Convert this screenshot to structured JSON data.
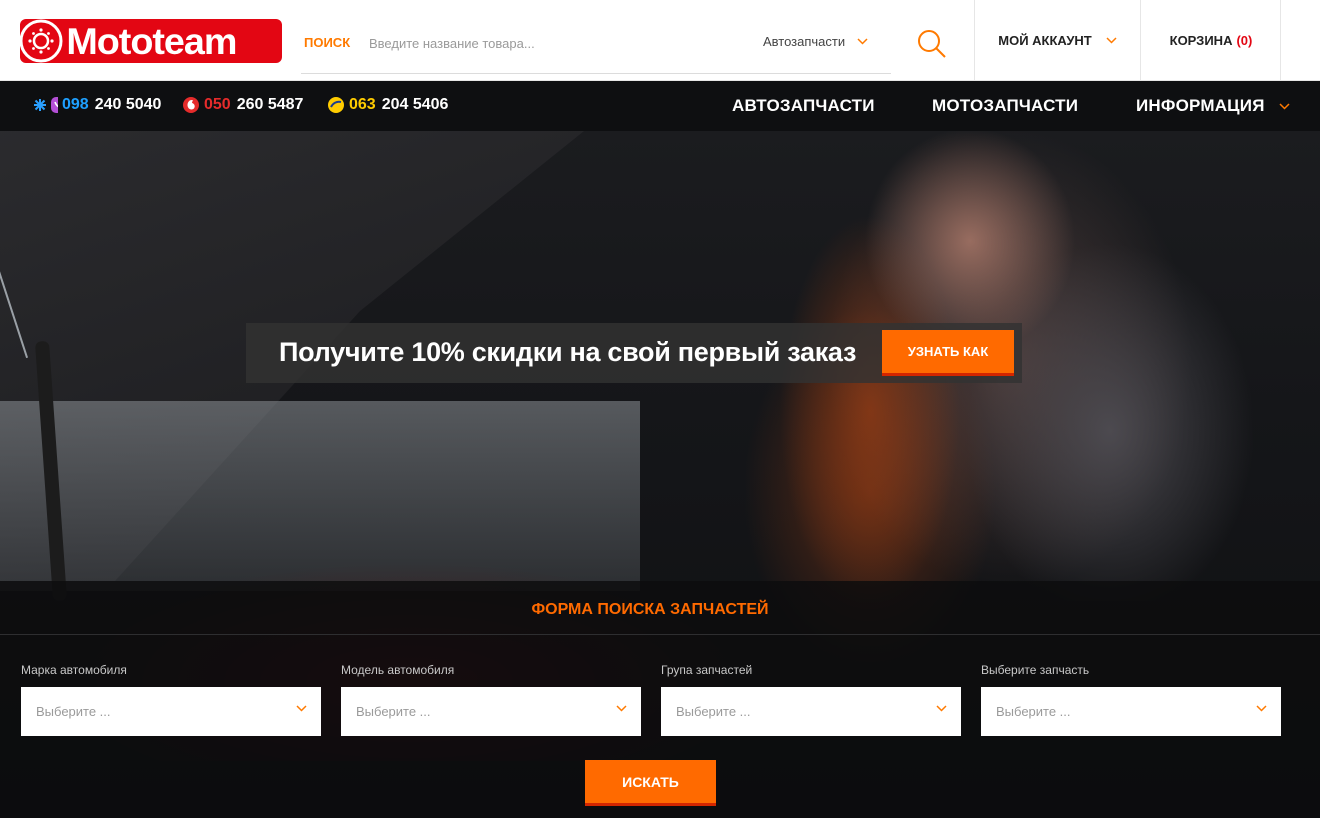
{
  "header": {
    "logo_text": "Mototeam",
    "search_label": "ПОИСК",
    "search_placeholder": "Введите название товара...",
    "search_value": "",
    "category_select": "Автозапчасти",
    "account_label": "МОЙ АККАУНТ",
    "cart_label": "КОРЗИНА",
    "cart_count": "(0)"
  },
  "phones": [
    {
      "code": "098",
      "number": "240 5040",
      "code_color": "#1ea0ff",
      "operator_icon": "kyivstar-viber-icon"
    },
    {
      "code": "050",
      "number": "260 5487",
      "code_color": "#e52b2b",
      "operator_icon": "vodafone-icon"
    },
    {
      "code": "063",
      "number": "204 5406",
      "code_color": "#ffcc00",
      "operator_icon": "lifecell-icon"
    }
  ],
  "nav": {
    "items": [
      "АВТОЗАПЧАСТИ",
      "МОТОЗАПЧАСТИ",
      "ИНФОРМАЦИЯ"
    ]
  },
  "hero": {
    "promo_text": "Получите 10% скидки на свой первый заказ",
    "promo_button": "УЗНАТЬ КАК"
  },
  "search_form": {
    "title": "ФОРМА ПОИСКА ЗАПЧАСТЕЙ",
    "fields": [
      {
        "label": "Марка автомобиля",
        "value": "Выберите ..."
      },
      {
        "label": "Модель автомобиля",
        "value": "Выберите ..."
      },
      {
        "label": "Група запчастей",
        "value": "Выберите ..."
      },
      {
        "label": "Выберите запчасть",
        "value": "Выберите ..."
      }
    ],
    "submit_label": "ИСКАТЬ"
  },
  "colors": {
    "brand_red": "#e30613",
    "accent_orange": "#ff6a00",
    "nav_bg": "#0e0f11"
  }
}
